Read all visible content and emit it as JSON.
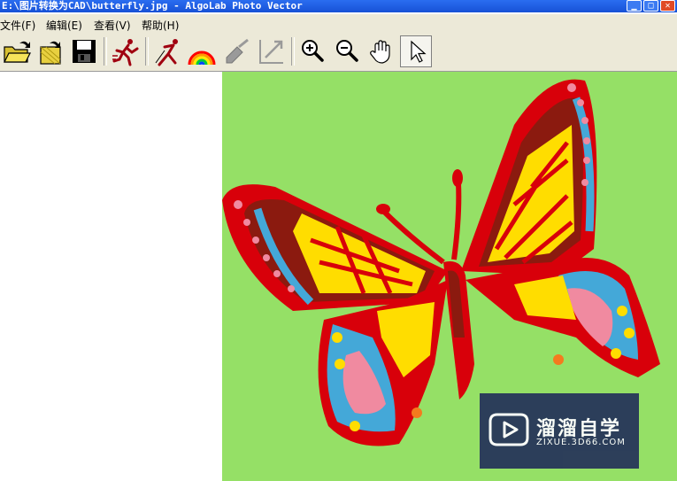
{
  "window": {
    "title": "E:\\图片转换为CAD\\butterfly.jpg - AlgoLab Photo Vector",
    "controls": [
      "minimize",
      "maximize",
      "close"
    ]
  },
  "menu": [
    {
      "label": "文件(F)"
    },
    {
      "label": "编辑(E)"
    },
    {
      "label": "查看(V)"
    },
    {
      "label": "帮助(H)"
    }
  ],
  "toolbar": {
    "buttons": [
      {
        "icon": "open-folder-icon"
      },
      {
        "icon": "open-document-icon"
      },
      {
        "icon": "save-disk-icon"
      },
      {
        "icon": "run-vectorize-icon"
      },
      {
        "icon": "run-figure-icon"
      },
      {
        "icon": "rainbow-colors-icon"
      },
      {
        "icon": "eraser-icon"
      },
      {
        "icon": "resize-arrow-icon"
      },
      {
        "icon": "zoom-in-icon"
      },
      {
        "icon": "zoom-out-icon"
      },
      {
        "icon": "hand-pan-icon"
      },
      {
        "icon": "arrow-pointer-icon",
        "pressed": true
      }
    ]
  },
  "image": {
    "file": "butterfly.jpg",
    "background_color": "#95e066",
    "colors": [
      "#d8000a",
      "#8b1a0f",
      "#ffdd00",
      "#44a8d8",
      "#f08aa0",
      "#f47a1e"
    ]
  },
  "watermark": {
    "brand_cn": "溜溜自学",
    "brand_en": "ZIXUE.3D66.COM"
  }
}
